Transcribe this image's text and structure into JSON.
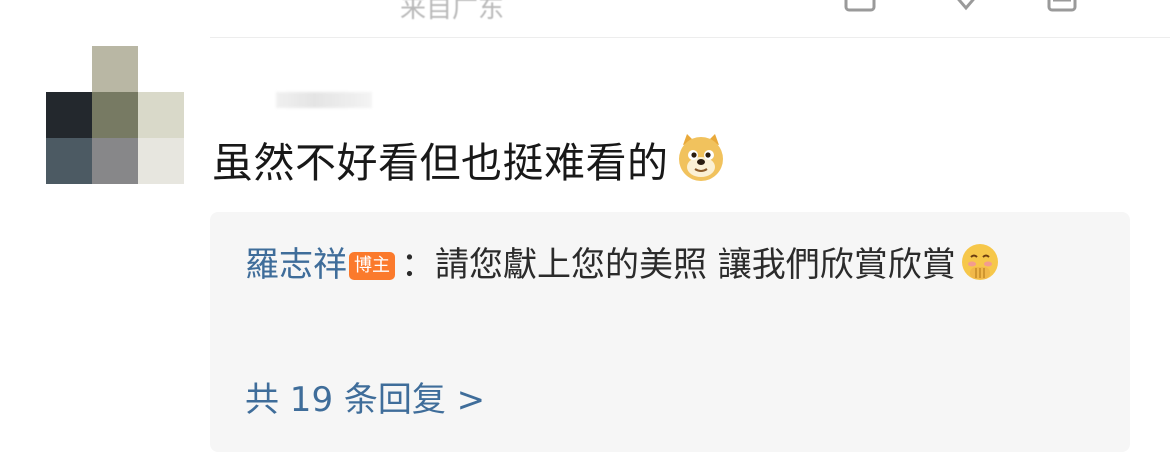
{
  "top_bar": {
    "cut_text": "来自广东",
    "icons": [
      "share-icon",
      "comment-icon",
      "like-icon"
    ]
  },
  "comment": {
    "text": "虽然不好看但也挺难看的",
    "emoji": "doge-emoji-icon"
  },
  "reply": {
    "author": "羅志祥",
    "badge": "博主",
    "separator": "：",
    "text": "請您獻上您的美照 讓我們欣賞欣賞",
    "emoji": "shy-face-emoji-icon"
  },
  "more_replies": {
    "label": "共 19 条回复 >"
  },
  "colors": {
    "link_blue": "#3f6d9a",
    "badge_orange": "#fb7a2c",
    "reply_bg": "#f6f6f6"
  }
}
